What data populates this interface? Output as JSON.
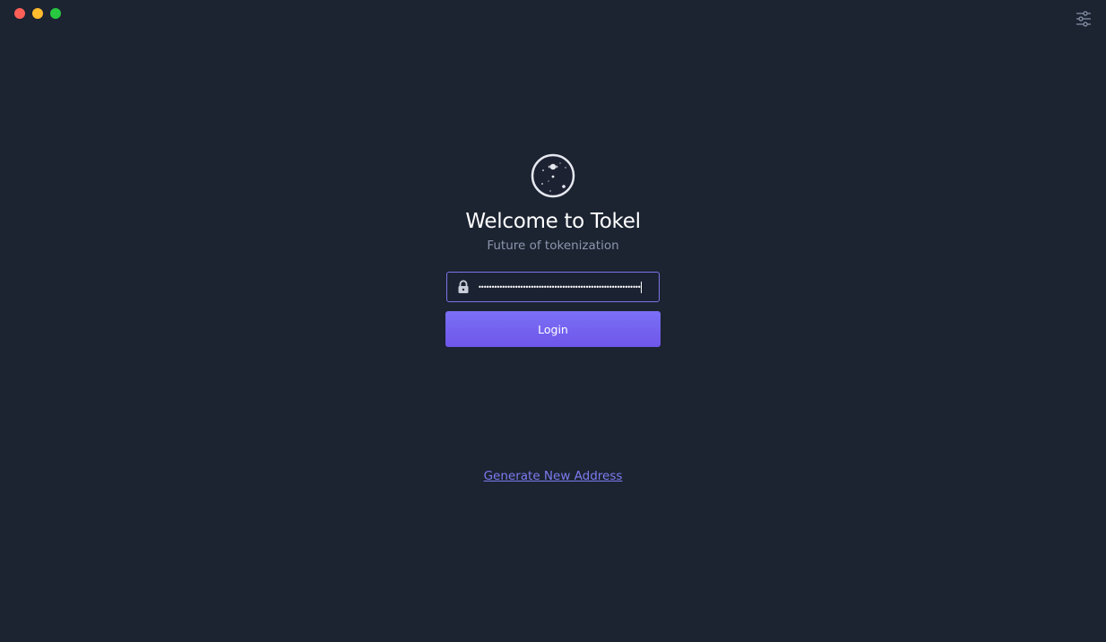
{
  "window": {
    "controls": [
      "close",
      "minimize",
      "maximize"
    ]
  },
  "header": {
    "settings_icon": "sliders-icon"
  },
  "login": {
    "logo_icon": "tokel-logo-icon",
    "title": "Welcome to Tokel",
    "subtitle": "Future of tokenization",
    "password": {
      "lock_icon": "lock-icon",
      "masked_value": "••••••••••••••••••••••••••••••••••••••••••••••••••••••••••••••"
    },
    "login_label": "Login",
    "generate_label": "Generate New Address"
  },
  "colors": {
    "background": "#1c2331",
    "accent": "#7b70f5",
    "link": "#7b7cf0",
    "subtitle": "#8c97ad"
  }
}
